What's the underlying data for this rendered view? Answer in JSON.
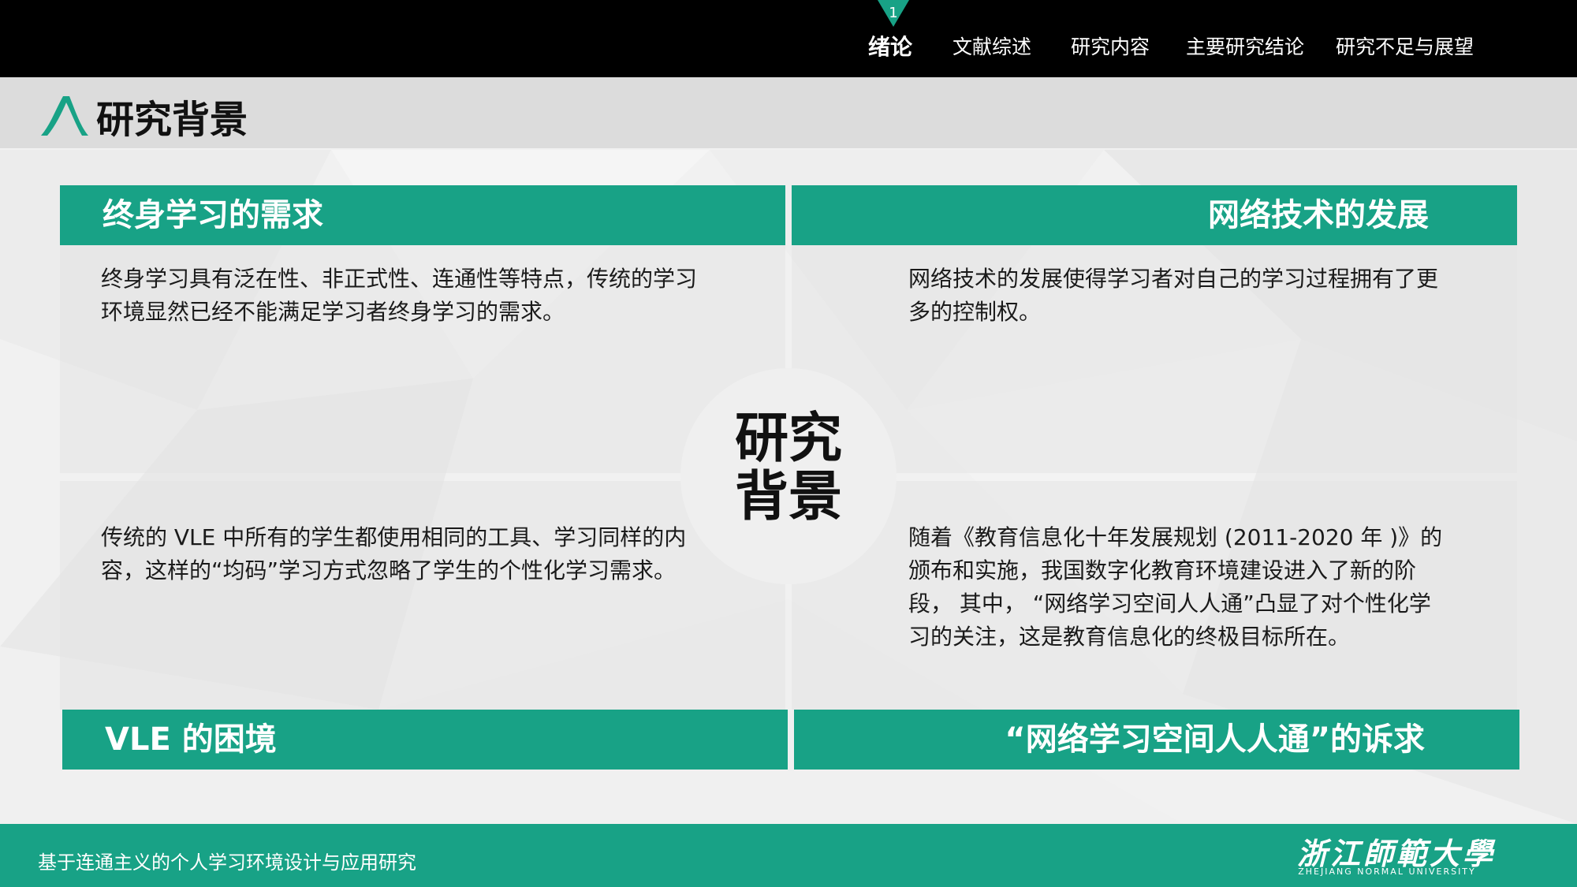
{
  "nav": {
    "marker_number": "1",
    "items": [
      "绪论",
      "文献综述",
      "研究内容",
      "主要研究结论",
      "研究不足与展望"
    ],
    "active_index": 0
  },
  "header": {
    "title": "研究背景"
  },
  "quadrants": {
    "top_left": {
      "heading": "终身学习的需求",
      "body": "终身学习具有泛在性、非正式性、连通性等特点，传统的学习环境显然已经不能满足学习者终身学习的需求。"
    },
    "top_right": {
      "heading": "网络技术的发展",
      "body": "网络技术的发展使得学习者对自己的学习过程拥有了更多的控制权。"
    },
    "bottom_left": {
      "heading": "VLE 的困境",
      "body": "传统的 VLE 中所有的学生都使用相同的工具、学习同样的内容，这样的“均码”学习方式忽略了学生的个性化学习需求。"
    },
    "bottom_right": {
      "heading": "“网络学习空间人人通”的诉求",
      "body": "随着《教育信息化十年发展规划 (2011-2020 年 )》的颁布和实施，我国数字化教育环境建设进入了新的阶段， 其中， “网络学习空间人人通”凸显了对个性化学习的关注，这是教育信息化的终极目标所在。"
    }
  },
  "center": {
    "line1": "研究",
    "line2": "背景"
  },
  "footer": {
    "title": "基于连通主义的个人学习环境设计与应用研究",
    "university_cn": "浙江師範大學",
    "university_en": "ZHEJIANG NORMAL UNIVERSITY"
  },
  "colors": {
    "accent": "#18a286",
    "topbar": "#000000",
    "title_band": "#dcdcdc"
  },
  "icons": {
    "title_logo": "green-arch-logo-icon",
    "nav_marker": "triangle-marker-icon"
  }
}
